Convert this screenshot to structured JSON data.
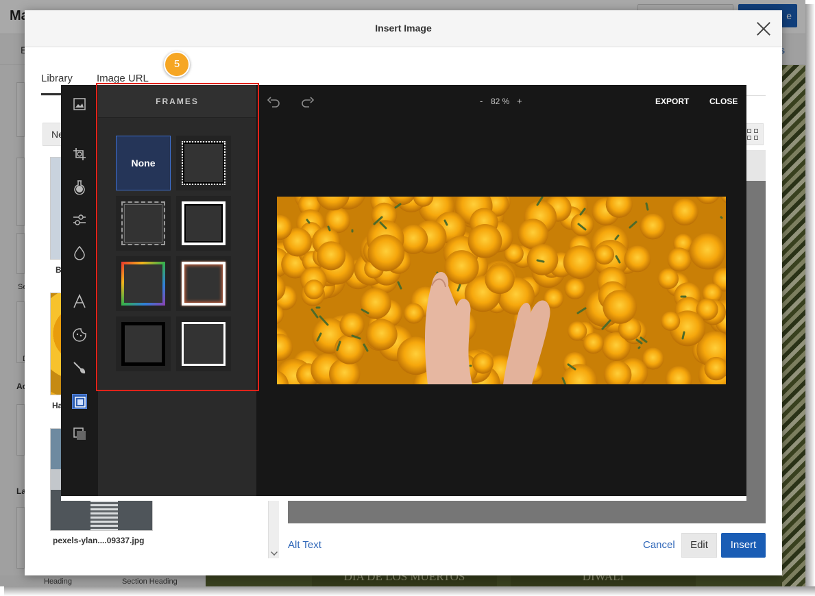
{
  "background_app": {
    "title": "Ma",
    "header_action_label": "e",
    "tab_letter": "E",
    "tab_right_label": "s",
    "side_letters": [
      "Se",
      "D",
      "Ac",
      "Ha",
      "La",
      "B"
    ],
    "bottom_labels": [
      "Heading",
      "Section Heading"
    ],
    "bottom_cards": [
      "DIA DE LOS MUERTOS",
      "DIWALI"
    ]
  },
  "modal": {
    "title": "Insert Image",
    "tabs": [
      {
        "label": "Library",
        "active": true
      },
      {
        "label": "Image URL",
        "active": false
      }
    ],
    "library": {
      "search_label": "Ne",
      "thumbnails": [
        {
          "caption": "B"
        },
        {
          "caption": "Ha"
        },
        {
          "caption": "pexels-ylan....09337.jpg"
        }
      ]
    },
    "footer": {
      "alt_text_label": "Alt Text",
      "cancel_label": "Cancel",
      "edit_label": "Edit",
      "insert_label": "Insert"
    }
  },
  "editor": {
    "zoom": {
      "minus": "-",
      "value": "82 %",
      "plus": "+"
    },
    "export_label": "EXPORT",
    "close_label": "CLOSE",
    "tools": [
      "image-tool-icon",
      "crop-icon",
      "filter-flask-icon",
      "adjust-sliders-icon",
      "drop-icon",
      "text-icon",
      "sticker-icon",
      "brush-icon",
      "frame-icon",
      "overlay-icon"
    ],
    "frames_panel": {
      "heading": "FRAMES",
      "frames": [
        {
          "label": "None",
          "selected": true
        },
        {
          "label": "",
          "style": "dotted"
        },
        {
          "label": "",
          "style": "ornate"
        },
        {
          "label": "",
          "style": "white-thick"
        },
        {
          "label": "",
          "style": "rainbow"
        },
        {
          "label": "",
          "style": "white-thin-glow"
        },
        {
          "label": "",
          "style": "black-thick"
        },
        {
          "label": "",
          "style": "white-medium"
        }
      ]
    }
  },
  "callout": {
    "step_number": "5",
    "highlight_color": "#e2231a",
    "badge_color": "#f6a623"
  },
  "colors": {
    "primary_blue": "#1a5db5",
    "link_blue": "#2e66b8",
    "editor_bg": "#171717"
  }
}
